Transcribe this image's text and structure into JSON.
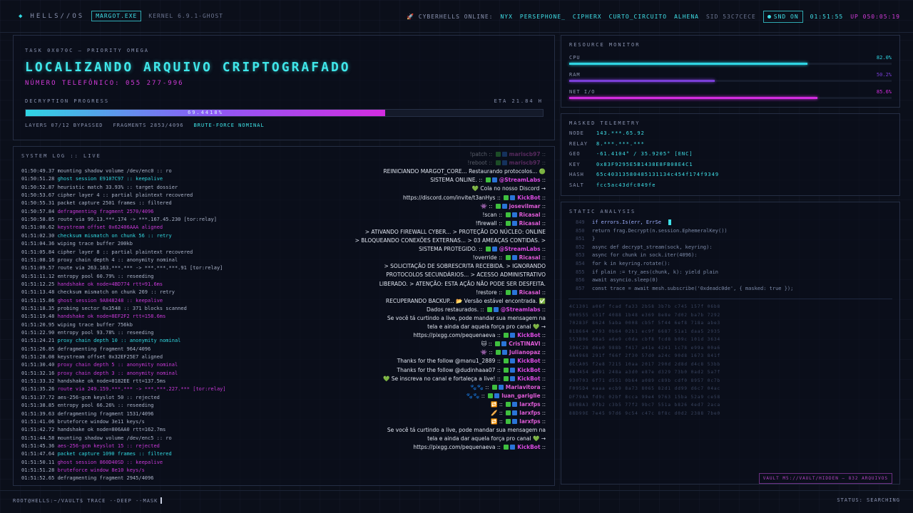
{
  "topbar": {
    "brand": "HELLS//OS",
    "active_proc": "MARGOT.EXE",
    "kernel": "KERNEL 6.9.1-GHOST",
    "online_label": "CYBERHELLS ONLINE:",
    "online_users": [
      "NYX",
      "PERSEPHONE_",
      "CIPHERX",
      "CURTO_CIRCUITO",
      "ALHENA"
    ],
    "sid": "SID 53C7CECE",
    "snd": "SND ON",
    "clock": "01:51:55",
    "uptime": "UP 050:05:19",
    "accent": "#3fe0e8",
    "accent2": "#d03ad8"
  },
  "task": {
    "label": "TASK 0X070C — PRIORITY OMEGA",
    "headline": "LOCALIZANDO ARQUIVO CRIPTOGRAFADO",
    "phone": "NÚMERO TELEFÔNICO: 055 277-996",
    "progress_label": "DECRYPTION PROGRESS",
    "eta": "ETA 21.84 H",
    "progress_pct": 69.5,
    "progress_text": "69.4418%",
    "layers": "LAYERS 07/12 BYPASSED",
    "fragments": "FRAGMENTS 2853/4096",
    "bruteforce": "BRUTE-FORCE NOMINAL"
  },
  "resource": {
    "title": "RESOURCE MONITOR",
    "items": [
      {
        "name": "CPU",
        "pct_text": "82.0%",
        "pct": 82.0,
        "color": "#2fd5e3"
      },
      {
        "name": "RAM",
        "pct_text": "50.2%",
        "pct": 50.2,
        "color": "#7a3fd8"
      },
      {
        "name": "NET I/O",
        "pct_text": "85.6%",
        "pct": 85.6,
        "color": "#d32ce0"
      }
    ]
  },
  "telemetry": {
    "title": "MASKED TELEMETRY",
    "rows": [
      {
        "k": "NODE",
        "v": "143.***.65.92"
      },
      {
        "k": "RELAY",
        "v": "8.***.***.***"
      },
      {
        "k": "GEO",
        "v": "-61.4104° / 35.9205° [ENC]"
      },
      {
        "k": "KEY",
        "v": "0x83F9295E5B1438E8FB08E4C1"
      },
      {
        "k": "HASH",
        "v": "65c40313580485131134c454f174f9349"
      },
      {
        "k": "SALT",
        "v": "fcc5ac43dfc049fe"
      }
    ]
  },
  "static": {
    "title": "STATIC ANALYSIS",
    "code": [
      {
        "ln": "849",
        "tx": "if errors.Is(err, ErrSe"
      },
      {
        "ln": "850",
        "tx": "return frag.Decrypt(n.session.EphemeralKey())"
      },
      {
        "ln": "851",
        "tx": "}"
      },
      {
        "ln": "852",
        "tx": "async def decrypt_stream(sock, keyring):"
      },
      {
        "ln": "853",
        "tx": "async for chunk in sock.iter(4096):"
      },
      {
        "ln": "854",
        "tx": "for k in keyring.rotate():"
      },
      {
        "ln": "855",
        "tx": "if plain := try_aes(chunk, k): yield plain"
      },
      {
        "ln": "856",
        "tx": "await asyncio.sleep(0)"
      },
      {
        "ln": "857",
        "tx": "const trace = await mesh.subscribe('0xdeadc0de', { masked: true });"
      }
    ],
    "hex": [
      "4C1301  a06f  fcad  fa33  2b58  3b7b  c745  157f  06b8",
      "000555  c51f  4088  1b48  e369  8e8e  7d02  ba7b  7292",
      "70283F  8624  5aba  0008  cb5f  5f44  6ef8  718a  abe3",
      "81B664  e793  0b64  02b1  ec9f  6687  51a1  daa5  2935",
      "553B06  68a5  a6e9  c0da  cbf8  fcd8  b09c  101d  3634",
      "396C28  d6e0  988b  f417  a41e  4241  1c78  e99a  00a6",
      "4A4968  291f  f66f  2f30  57d0  a24c  90d8  1673  841f",
      "6CCA05  f2e8  7215  10aa  2017  290d  2d8d  d4c8  53bb",
      "6A3454  ad91  248a  a3d0  e87e  d329  73b0  0ad2  5a7f",
      "930703  6f71  d551  0b64  a089  c89b  cdf0  8957  0c7b",
      "F095D4  eaaa  ecb9  8a73  8065  82d1  dd99  d6c7  04ac",
      "DF79AA  fd9c  02bf  8cca  99e4  9763  15ba  52a9  ce58",
      "BE0BA3  07b2  c3b5  77f2  9bc7  551a  b826  4ed7  2aca",
      "88D99E  7e45  97d6  9c54  c47c  8f8c  d0d2  2388  7be0"
    ],
    "vault": "VAULT M5://VAULT/HIDDEN — 832 ARQUIVOS"
  },
  "syslog": {
    "title": "SYSTEM LOG :: LIVE",
    "lines": [
      {
        "t": "01:50:49.37",
        "msg": "mounting shadow volume /dev/enc0 :: ro",
        "c": ""
      },
      {
        "t": "01:50:51.28",
        "msg": "ghost session E9107C97 :: keepalive",
        "c": "cyan"
      },
      {
        "t": "01:50:52.87",
        "msg": "heuristic match 33.93% :: target dossier",
        "c": ""
      },
      {
        "t": "01:50:53.67",
        "msg": "cipher layer 4 :: partial plaintext recovered",
        "c": ""
      },
      {
        "t": "01:50:55.31",
        "msg": "packet capture 2501 frames :: filtered",
        "c": ""
      },
      {
        "t": "01:50:57.84",
        "msg": "defragmenting fragment 2570/4096",
        "c": "magenta"
      },
      {
        "t": "01:50:58.85",
        "msg": "route via 99.13.***.174 -> ***.167.45.230 [tor:relay]",
        "c": ""
      },
      {
        "t": "01:51:00.62",
        "msg": "keystream offset 0x62406AAA aligned",
        "c": "magenta"
      },
      {
        "t": "01:51:02.30",
        "msg": "checksum mismatch on chunk 56 :: retry",
        "c": "cyan"
      },
      {
        "t": "01:51:04.36",
        "msg": "wiping trace buffer 200kb",
        "c": ""
      },
      {
        "t": "01:51:05.84",
        "msg": "cipher layer 8 :: partial plaintext recovered",
        "c": ""
      },
      {
        "t": "01:51:08.16",
        "msg": "proxy chain depth 4 :: anonymity nominal",
        "c": ""
      },
      {
        "t": "01:51:09.57",
        "msg": "route via 263.163.***.*** -> ***.***.***.91 [tor:relay]",
        "c": ""
      },
      {
        "t": "01:51:11.12",
        "msg": "entropy pool 60.79% :: reseeding",
        "c": ""
      },
      {
        "t": "01:51:12.25",
        "msg": "handshake ok node=4BD774 rtt=91.6ms",
        "c": "magenta"
      },
      {
        "t": "01:51:13.48",
        "msg": "checksum mismatch on chunk 269 :: retry",
        "c": ""
      },
      {
        "t": "01:51:15.86",
        "msg": "ghost session 9A848248 :: keepalive",
        "c": "magenta"
      },
      {
        "t": "01:51:18.35",
        "msg": "probing sector 0x3548 :: 371 blocks scanned",
        "c": ""
      },
      {
        "t": "01:51:19.48",
        "msg": "handshake ok node=8EF2F2 rtt=158.6ms",
        "c": "magenta"
      },
      {
        "t": "01:51:20.95",
        "msg": "wiping trace buffer 756kb",
        "c": ""
      },
      {
        "t": "01:51:22.90",
        "msg": "entropy pool 93.78% :: reseeding",
        "c": ""
      },
      {
        "t": "01:51:24.21",
        "msg": "proxy chain depth 10 :: anonymity nominal",
        "c": "cyan"
      },
      {
        "t": "01:51:26.85",
        "msg": "defragmenting fragment 964/4096",
        "c": ""
      },
      {
        "t": "01:51:28.08",
        "msg": "keystream offset 0x32EF25E7 aligned",
        "c": ""
      },
      {
        "t": "01:51:30.40",
        "msg": "proxy chain depth 5 :: anonymity nominal",
        "c": "magenta"
      },
      {
        "t": "01:51:32.16",
        "msg": "proxy chain depth 3 :: anonymity nominal",
        "c": "magenta"
      },
      {
        "t": "01:51:33.32",
        "msg": "handshake ok node=0182EE rtt=137.5ms",
        "c": ""
      },
      {
        "t": "01:51:35.26",
        "msg": "route via 249.159.***.*** -> ***.***.227.*** [tor:relay]",
        "c": "magenta"
      },
      {
        "t": "01:51:37.72",
        "msg": "aes-256-gcm keyslot 50 :: rejected",
        "c": ""
      },
      {
        "t": "01:51:38.85",
        "msg": "entropy pool 66.26% :: reseeding",
        "c": ""
      },
      {
        "t": "01:51:39.63",
        "msg": "defragmenting fragment 1531/4096",
        "c": ""
      },
      {
        "t": "01:51:41.06",
        "msg": "bruteforce window 3e11 keys/s",
        "c": ""
      },
      {
        "t": "01:51:42.72",
        "msg": "handshake ok node=806AA0 rtt=162.7ms",
        "c": ""
      },
      {
        "t": "01:51:44.58",
        "msg": "mounting shadow volume /dev/enc5 :: ro",
        "c": ""
      },
      {
        "t": "01:51:45.36",
        "msg": "aes-256-gcm keyslot 15 :: rejected",
        "c": "magenta"
      },
      {
        "t": "01:51:47.64",
        "msg": "packet capture 1090 frames :: filtered",
        "c": "cyan"
      },
      {
        "t": "01:51:50.11",
        "msg": "ghost session 860D40SD :: keepalive",
        "c": "magenta"
      },
      {
        "t": "01:51:51.28",
        "msg": "bruteforce window 8e10 keys/s",
        "c": "magenta"
      },
      {
        "t": "01:51:52.65",
        "msg": "defragmenting fragment 2945/4096",
        "c": ""
      }
    ]
  },
  "chat": [
    {
      "text": "!patch",
      "user": "mariscb97",
      "faded": true
    },
    {
      "text": "!reboot",
      "user": "mariscb97",
      "faded": true
    },
    {
      "text": "REINICIANDO MARGOT_CORE... Restaurando protocolos... 🟢",
      "user": "",
      "faded": false
    },
    {
      "text": "SISTEMA ONLINE.",
      "user": "@StreamLabs",
      "faded": false
    },
    {
      "text": "💚 Cola no nosso Discord →",
      "user": "",
      "faded": false
    },
    {
      "text": "https://discord.com/invite/t3anHys",
      "user": "KickBot",
      "faded": false
    },
    {
      "text": "👾",
      "user": "josevilmar",
      "faded": false
    },
    {
      "text": "!scan",
      "user": "Ricasal",
      "faded": false
    },
    {
      "text": "!firewall",
      "user": "Ricasal",
      "faded": false
    },
    {
      "text": "> ATIVANDO FIREWALL CYBER... > PROTEÇÃO DO NÚCLEO: ONLINE",
      "user": "",
      "faded": false
    },
    {
      "text": "> BLOQUEANDO CONEXÕES EXTERNAS... > 03 AMEAÇAS CONTIDAS. >",
      "user": "",
      "faded": false
    },
    {
      "text": "SISTEMA PROTEGIDO.",
      "user": "@StreamLabs",
      "faded": false
    },
    {
      "text": "!override",
      "user": "Ricasal",
      "faded": false
    },
    {
      "text": "> SOLICITAÇÃO DE SOBRESCRITA RECEBIDA. > IGNORANDO",
      "user": "",
      "faded": false
    },
    {
      "text": "PROTOCOLOS SECUNDÁRIOS... > ACESSO ADMINISTRATIVO",
      "user": "",
      "faded": false
    },
    {
      "text": "LIBERADO. > ATENÇÃO: ESTA AÇÃO NÃO PODE SER DESFEITA.",
      "user": "",
      "faded": false
    },
    {
      "text": "!restore",
      "user": "Ricasal",
      "faded": false
    },
    {
      "text": "RECUPERANDO BACKUP... 📂 Versão estável encontrada. ✅",
      "user": "",
      "faded": false
    },
    {
      "text": "Dados restaurados.",
      "user": "@Streamlabs",
      "faded": false
    },
    {
      "text": "Se você tá curtindo a live, pode mandar sua mensagem na",
      "user": "",
      "faded": false
    },
    {
      "text": "tela e ainda dar aquela força pro canal 💚 →",
      "user": "",
      "faded": false
    },
    {
      "text": "https://pixgg.com/pequenaeva",
      "user": "KickBot",
      "faded": false
    },
    {
      "text": "🐱",
      "user": "CrisTINAVI",
      "faded": false
    },
    {
      "text": "👾",
      "user": "Julianopaz",
      "faded": false
    },
    {
      "text": "Thanks for the follow @manu1_2889",
      "user": "KickBot",
      "faded": false
    },
    {
      "text": "Thanks for the follow @dudinhaaa07",
      "user": "KickBot",
      "faded": false
    },
    {
      "text": "💚 Se inscreva no canal e fortaleça a live!",
      "user": "KickBot",
      "faded": false
    },
    {
      "text": "🐾🐾",
      "user": "Mariavitora",
      "faded": false
    },
    {
      "text": "🐾🐾",
      "user": "luan_gariglie",
      "faded": false
    },
    {
      "text": "🔁",
      "user": "larxfps",
      "faded": false
    },
    {
      "text": "🥖",
      "user": "larxfps",
      "faded": false
    },
    {
      "text": "🔁",
      "user": "larxfps",
      "faded": false
    },
    {
      "text": "Se você tá curtindo a live, pode mandar sua mensagem na",
      "user": "",
      "faded": false
    },
    {
      "text": "tela e ainda dar aquela força pro canal 💚 →",
      "user": "",
      "faded": false
    },
    {
      "text": "https://pixgg.com/pequenaeva",
      "user": "KickBot",
      "faded": false
    }
  ],
  "footer": {
    "prompt": "ROOT@HELLS:~/VAULT$ TRACE --DEEP --MASK",
    "status": "STATUS: SEARCHING"
  }
}
